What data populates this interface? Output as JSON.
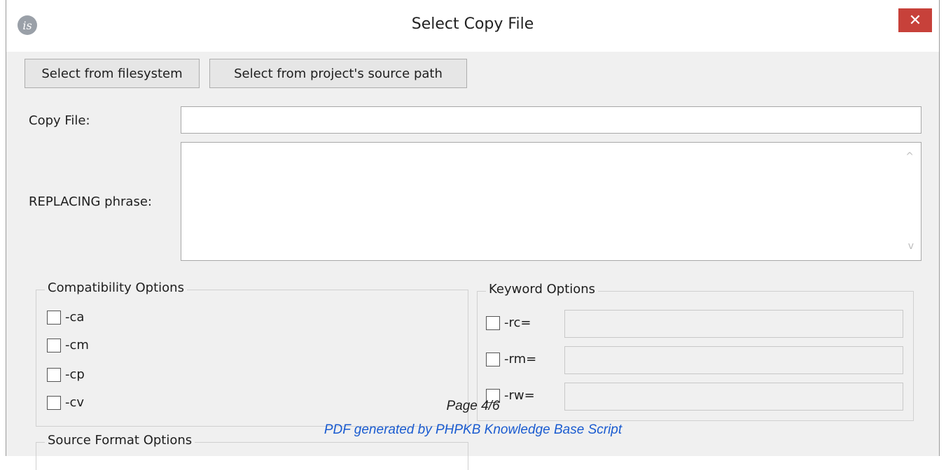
{
  "window": {
    "title": "Select Copy File",
    "app_icon": "is",
    "close_symbol": "✕"
  },
  "toolbar": {
    "select_filesystem": "Select from filesystem",
    "select_project": "Select from project's source path"
  },
  "form": {
    "copy_file_label": "Copy File:",
    "copy_file_value": "",
    "replacing_label": "REPLACING phrase:",
    "replacing_value": "",
    "scroll_up": "^",
    "scroll_down": "v"
  },
  "compatibility": {
    "title": "Compatibility Options",
    "options": [
      {
        "label": "-ca",
        "checked": false
      },
      {
        "label": "-cm",
        "checked": false
      },
      {
        "label": "-cp",
        "checked": false
      },
      {
        "label": "-cv",
        "checked": false
      }
    ]
  },
  "keyword": {
    "title": "Keyword Options",
    "options": [
      {
        "label": "-rc=",
        "checked": false,
        "value": ""
      },
      {
        "label": "-rm=",
        "checked": false,
        "value": ""
      },
      {
        "label": "-rw=",
        "checked": false,
        "value": ""
      }
    ]
  },
  "source_format": {
    "title": "Source Format Options"
  },
  "overlay": {
    "page": "Page 4/6",
    "pdf_note": "PDF generated by PHPKB Knowledge Base Script"
  },
  "colors": {
    "close_button": "#c7413a",
    "dialog_bg": "#f0f0f0",
    "overlay_link": "#1a5bd0"
  }
}
